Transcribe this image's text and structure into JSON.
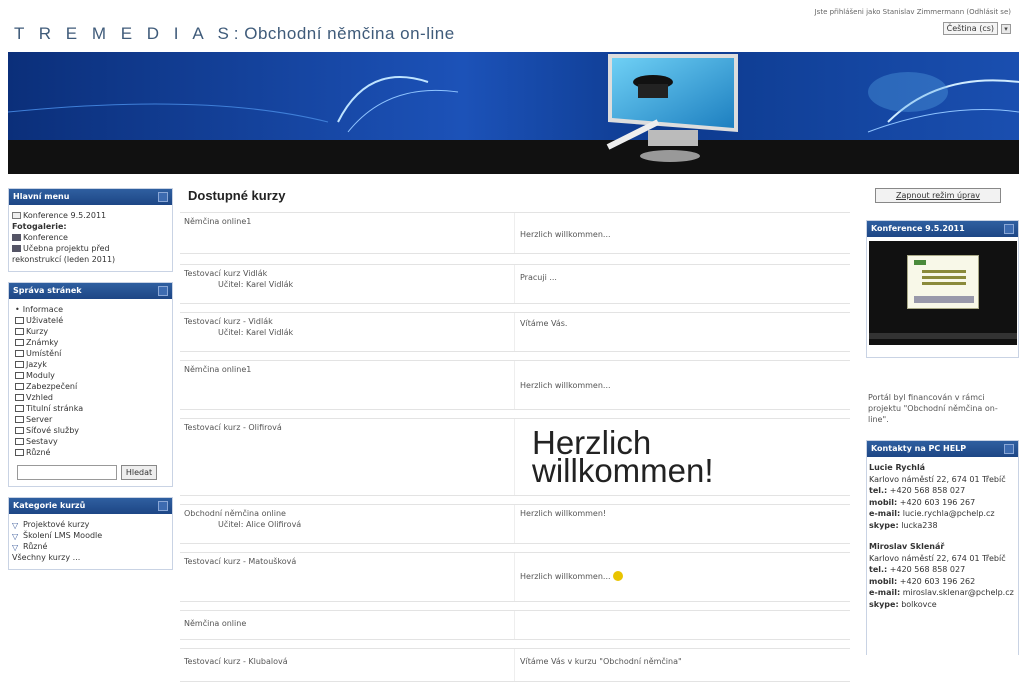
{
  "header": {
    "title_prefix": "T R E M E D I A S",
    "title_rest": ": Obchodní němčina on-line",
    "login_text": "Jste přihlášeni jako Stanislav Zimmermann (Odhlásit se)",
    "language": "Čeština (cs)"
  },
  "left": {
    "main_menu": {
      "title": "Hlavní menu",
      "items": [
        "Konference 9.5.2011",
        "Fotogalerie:",
        "Konference",
        "Učebna projektu před",
        "rekonstrukcí (leden 2011)"
      ]
    },
    "site_admin": {
      "title": "Správa stránek",
      "items": [
        "Informace",
        "Uživatelé",
        "Kurzy",
        "Známky",
        "Umístění",
        "Jazyk",
        "Moduly",
        "Zabezpečení",
        "Vzhled",
        "Titulní stránka",
        "Server",
        "Síťové služby",
        "Sestavy",
        "Různé"
      ],
      "search_button": "Hledat"
    },
    "categories": {
      "title": "Kategorie kurzů",
      "items": [
        "Projektové kurzy",
        "Školení LMS Moodle",
        "Různé",
        "Všechny kurzy ..."
      ]
    }
  },
  "main": {
    "title": "Dostupné kurzy",
    "courses": [
      {
        "name": "Němčina online1",
        "teacher": "",
        "summary": "Herzlich willkommen..."
      },
      {
        "name": "Testovací kurz Vidlák",
        "teacher": "Učitel: Karel Vidlák",
        "summary": "Pracuji ..."
      },
      {
        "name": "Testovací kurz - Vidlák",
        "teacher": "Učitel: Karel Vidlák",
        "summary": "Vítáme Vás."
      },
      {
        "name": "Němčina online1",
        "teacher": "",
        "summary": "Herzlich willkommen..."
      },
      {
        "name": "Testovací kurz - Olifirová",
        "teacher": "",
        "summary_big_1": "Herzlich",
        "summary_big_2": "willkommen!"
      },
      {
        "name": "Obchodní němčina online",
        "teacher": "Učitel: Alice Olifirová",
        "summary": "Herzlich willkommen!"
      },
      {
        "name": "Testovací kurz - Matoušková",
        "teacher": "",
        "summary": "Herzlich willkommen..."
      },
      {
        "name": "Němčina online",
        "teacher": "",
        "summary": ""
      },
      {
        "name": "Testovací kurz - Klubalová",
        "teacher": "",
        "summary": "Vítáme Vás v kurzu \"Obchodní němčina\""
      }
    ]
  },
  "right": {
    "edit_button": "Zapnout režim úprav",
    "conference_title": "Konference 9.5.2011",
    "portal_text": "Portál byl financován v rámci projektu \"Obchodní němčina on-line\".",
    "contacts_title": "Kontakty na PC HELP",
    "contacts": [
      {
        "name": "Lucie Rychlá",
        "address": "Karlovo náměstí 22, 674 01 Třebíč",
        "tel_label": "tel.:",
        "tel": "+420 568 858 027",
        "mobil_label": "mobil:",
        "mobil": "+420 603 196 267",
        "email_label": "e-mail:",
        "email": "lucie.rychla@pchelp.cz",
        "skype_label": "skype:",
        "skype": "lucka238"
      },
      {
        "name": "Miroslav Sklenář",
        "address": "Karlovo náměstí 22, 674 01 Třebíč",
        "tel_label": "tel.:",
        "tel": "+420 568 858 027",
        "mobil_label": "mobil:",
        "mobil": "+420 603 196 262",
        "email_label": "e-mail:",
        "email": "miroslav.sklenar@pchelp.cz",
        "skype_label": "skype:",
        "skype": "bolkovce"
      }
    ]
  }
}
